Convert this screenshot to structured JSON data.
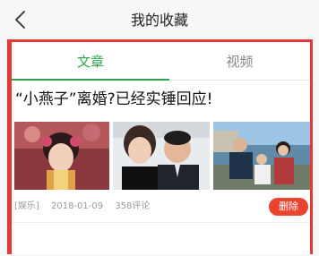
{
  "header": {
    "title": "我的收藏",
    "back_icon": "chevron-left-icon"
  },
  "tabs": [
    {
      "label": "文章",
      "active": true
    },
    {
      "label": "视频",
      "active": false
    }
  ],
  "colors": {
    "accent_green": "#2ea44f",
    "delete_red": "#e8442e",
    "highlight_red": "#e53935"
  },
  "articles": [
    {
      "title": "“小燕子”离婚?已经实锤回应!",
      "category": "[娱乐]",
      "date": "2018-01-09",
      "comments": "358评论",
      "delete_label": "删除"
    }
  ]
}
